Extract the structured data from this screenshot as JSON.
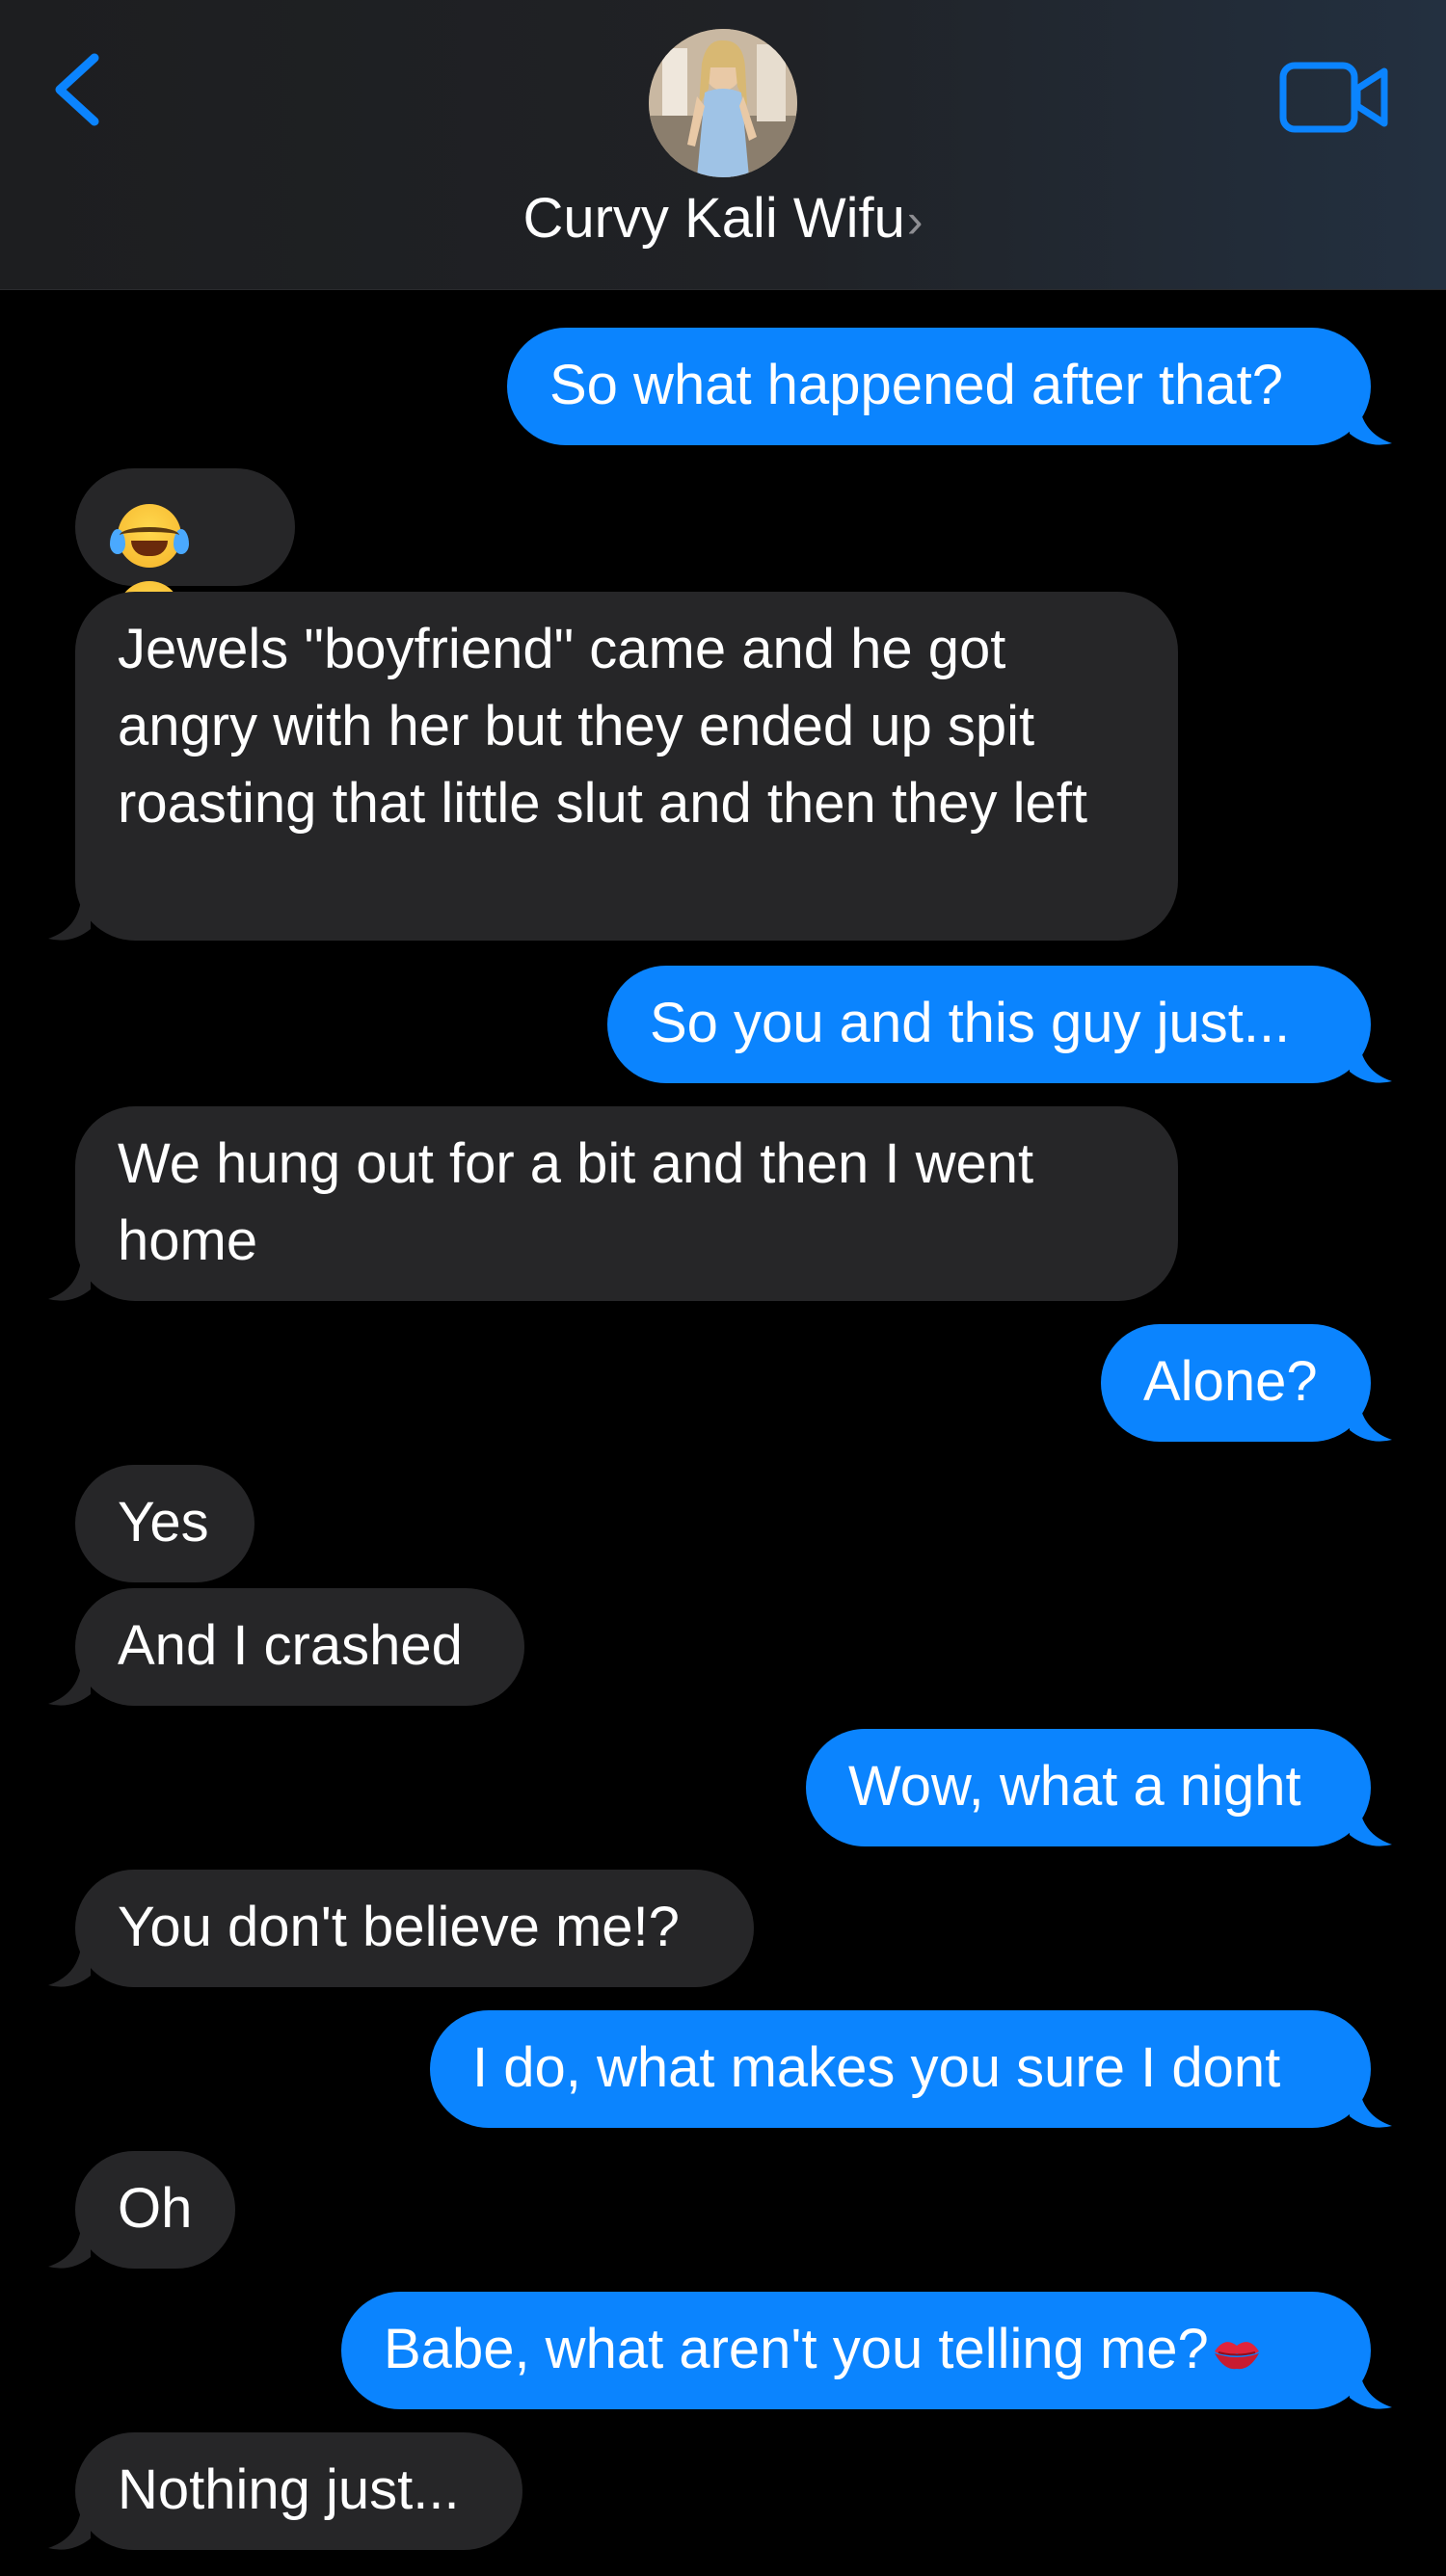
{
  "header": {
    "contact_name": "Curvy Kali Wifu",
    "chevron": "›",
    "back_icon": "chevron-left-icon",
    "video_icon": "video-camera-icon",
    "accent_color": "#0b84fe"
  },
  "messages": [
    {
      "from": "me",
      "text": "So what happened after that?"
    },
    {
      "from": "them",
      "text": "",
      "emoji": "face-with-tears-of-joy x2"
    },
    {
      "from": "them",
      "text": "Jewels \"boyfriend\" came and he got angry with her but they ended up spit roasting that little slut and then they left"
    },
    {
      "from": "me",
      "text": "So you and this guy just..."
    },
    {
      "from": "them",
      "text": "We hung out for a bit and then I went home"
    },
    {
      "from": "me",
      "text": "Alone?"
    },
    {
      "from": "them",
      "text": "Yes"
    },
    {
      "from": "them",
      "text": "And I crashed"
    },
    {
      "from": "me",
      "text": "Wow, what a night"
    },
    {
      "from": "them",
      "text": "You don't believe me!?"
    },
    {
      "from": "me",
      "text": "I do, what makes you sure I dont"
    },
    {
      "from": "them",
      "text": "Oh"
    },
    {
      "from": "me",
      "text": "Babe, what aren't you telling me?",
      "emoji": "kiss-mark"
    },
    {
      "from": "them",
      "text": "Nothing just..."
    }
  ],
  "colors": {
    "sent_bubble": "#0b84fe",
    "received_bubble": "#262628",
    "background": "#000000"
  }
}
